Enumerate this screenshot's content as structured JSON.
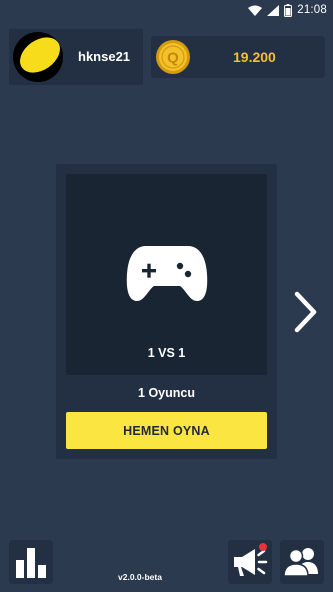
{
  "status_bar": {
    "time": "21:08",
    "icons": [
      "wifi-icon",
      "signal-icon",
      "battery-icon"
    ]
  },
  "profile": {
    "username": "hknse21",
    "avatar_color": "#f7dc1b"
  },
  "coins": {
    "icon_letter": "Q",
    "amount": "19.200",
    "color": "#f2c22b"
  },
  "game_mode": {
    "icon": "gamepad-icon",
    "label": "1 VS 1",
    "players": "1 Oyuncu",
    "play_button_label": "HEMEN OYNA",
    "play_button_color": "#fbe541"
  },
  "navigation": {
    "next_icon": "chevron-right-icon"
  },
  "bottom_bar": {
    "stats_icon": "bar-chart-icon",
    "announcements_icon": "megaphone-icon",
    "friends_icon": "users-icon",
    "version": "v2.0.0-beta"
  },
  "colors": {
    "background": "#2b3a4f",
    "card": "#233043",
    "panel": "#1a2533",
    "notification": "#e8323c"
  }
}
